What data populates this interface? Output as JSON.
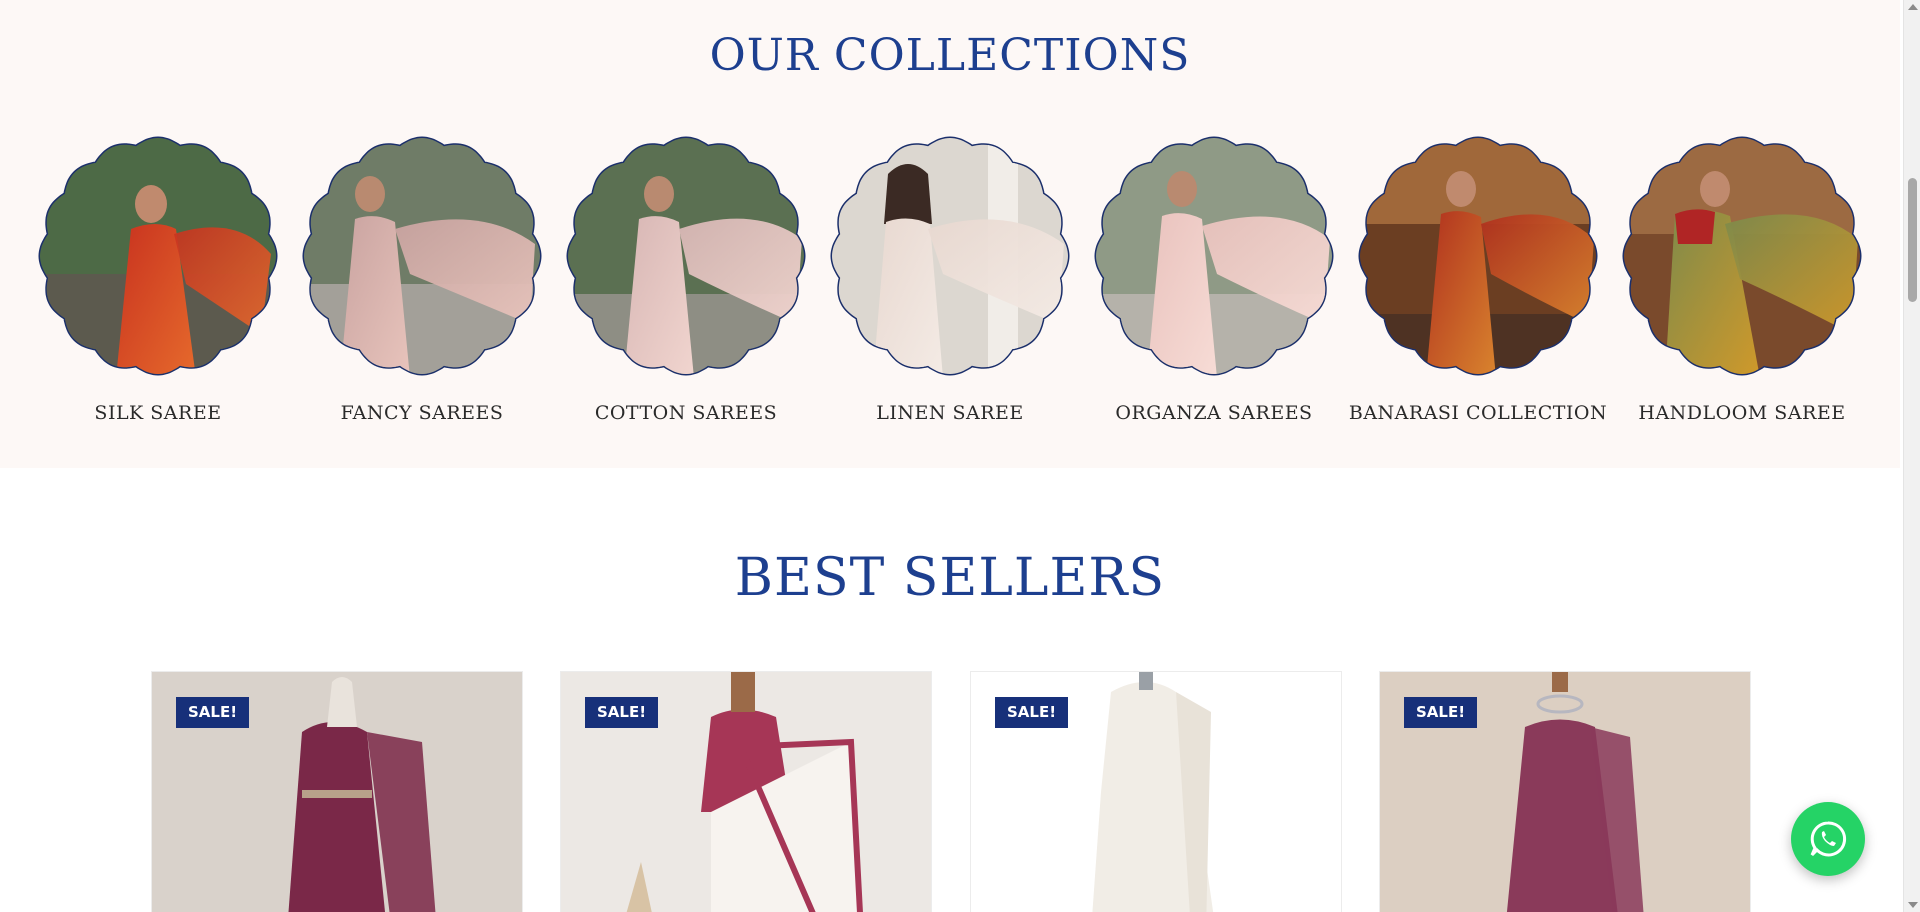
{
  "collections": {
    "title": "OUR COLLECTIONS",
    "items": [
      {
        "label": "SILK SAREE",
        "colors": [
          "#c8321f",
          "#e66a2c"
        ]
      },
      {
        "label": "FANCY SAREES",
        "colors": [
          "#c9a3a0",
          "#e8c4bc"
        ]
      },
      {
        "label": "COTTON SAREES",
        "colors": [
          "#d7b6b4",
          "#f1d5cf"
        ]
      },
      {
        "label": "LINEN SAREE",
        "colors": [
          "#e8d8d0",
          "#f4ebe5"
        ]
      },
      {
        "label": "ORGANZA SAREES",
        "colors": [
          "#e9c2bd",
          "#f7dcd6"
        ]
      },
      {
        "label": "BANARASI COLLECTION",
        "colors": [
          "#b0301e",
          "#d9842e"
        ]
      },
      {
        "label": "HANDLOOM SAREE",
        "colors": [
          "#7d8a4b",
          "#d0992a"
        ]
      }
    ]
  },
  "best_sellers": {
    "title": "BEST SELLERS",
    "products": [
      {
        "badge": "SALE!",
        "colors": [
          "#d9d2cb",
          "#7a2848"
        ]
      },
      {
        "badge": "SALE!",
        "colors": [
          "#ece8e4",
          "#a63656"
        ]
      },
      {
        "badge": "SALE!",
        "colors": [
          "#ffffff",
          "#f1ede6"
        ]
      },
      {
        "badge": "SALE!",
        "colors": [
          "#dccfc2",
          "#8a3a5a"
        ]
      }
    ]
  },
  "theme": {
    "accent": "#1d3f8f",
    "badge": "#17307a",
    "whatsapp": "#25d366"
  },
  "icons": {
    "chat": "whatsapp-icon"
  }
}
